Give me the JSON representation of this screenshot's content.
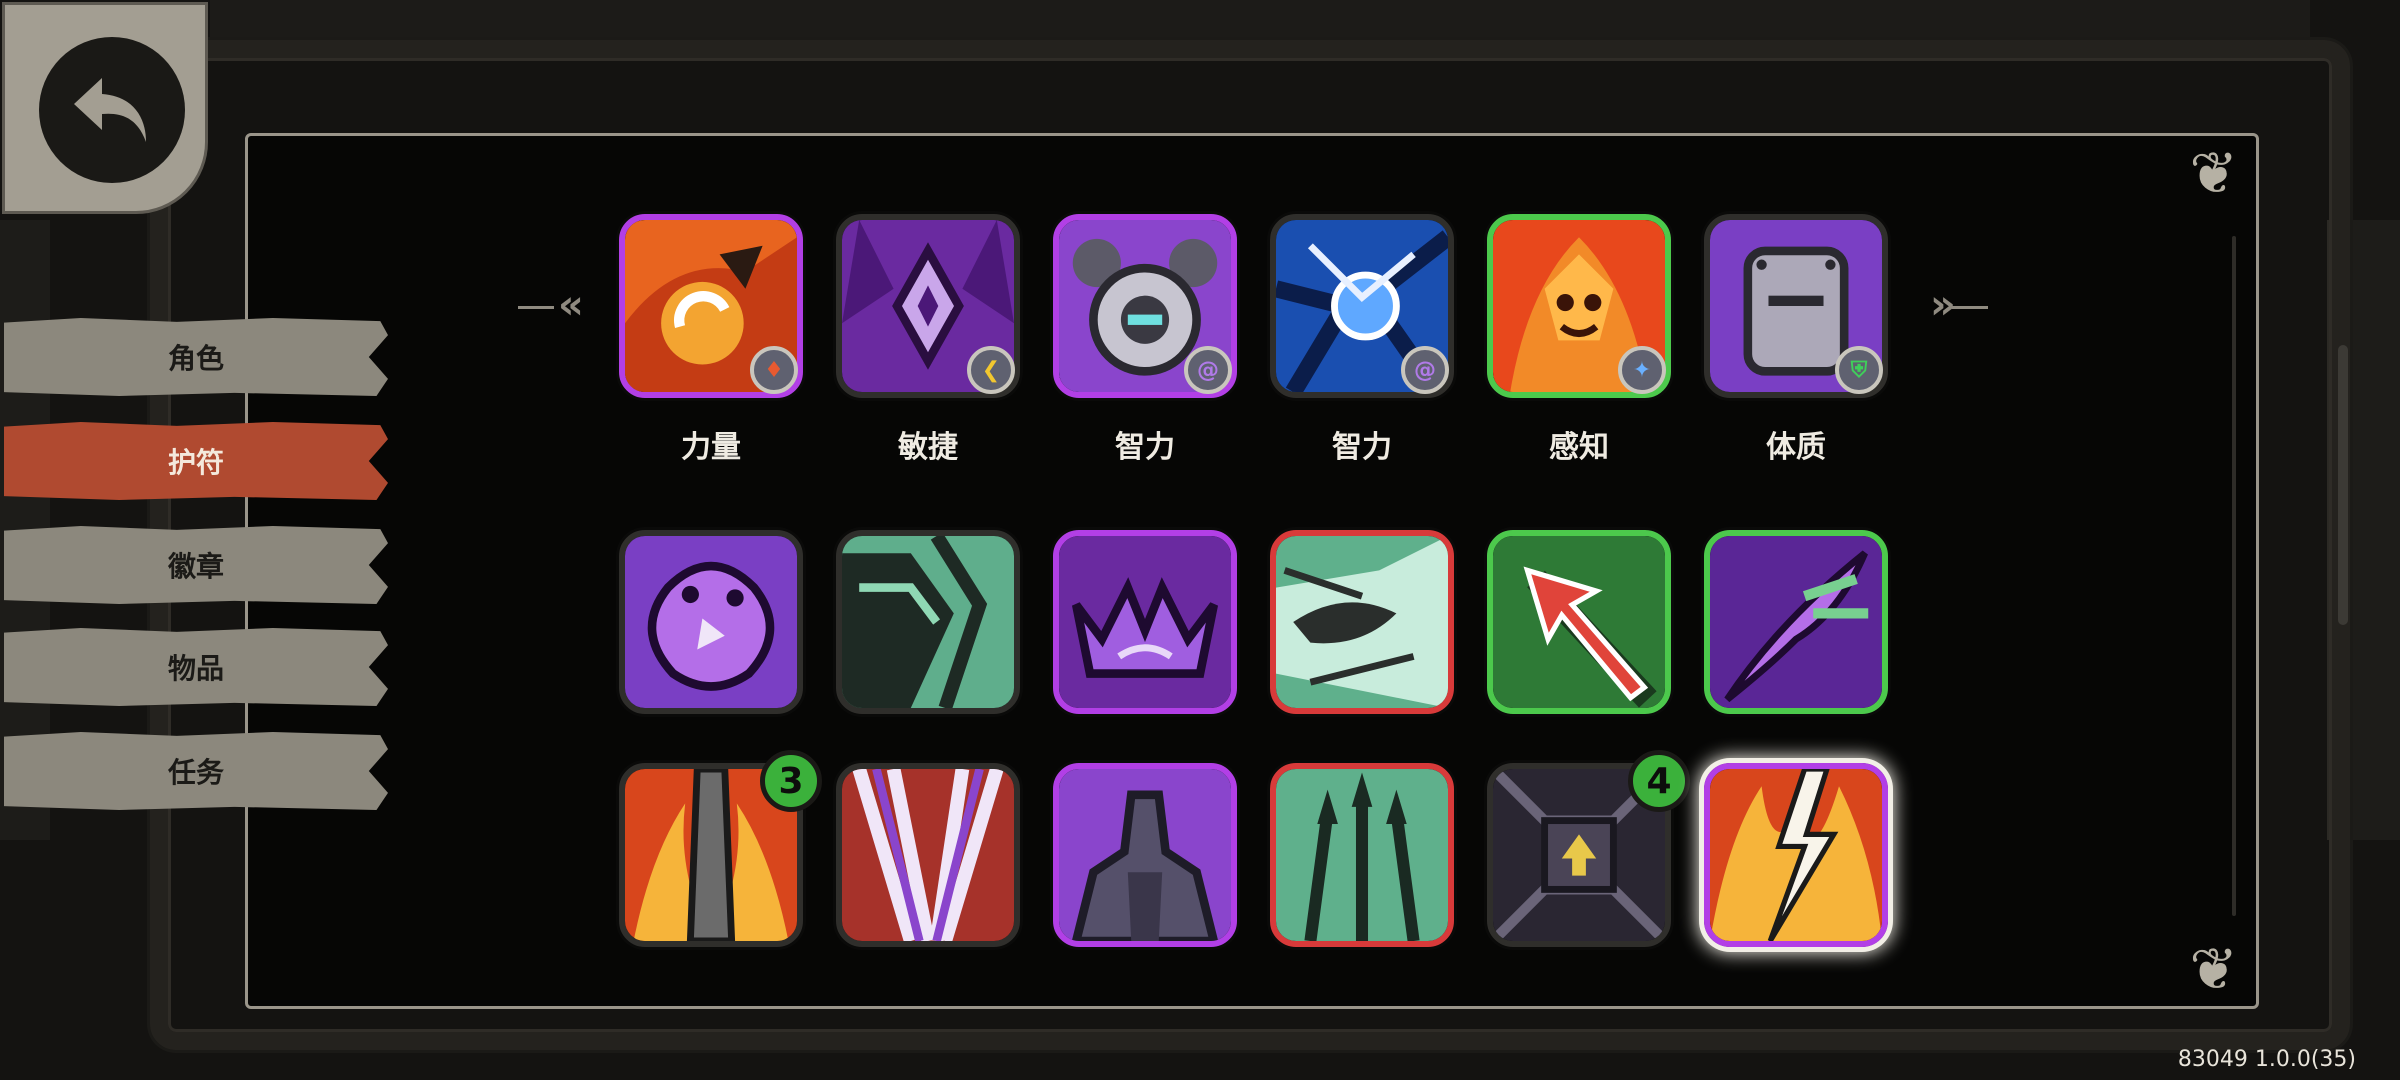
{
  "tabs": [
    {
      "label": "角色",
      "active": false
    },
    {
      "label": "护符",
      "active": true
    },
    {
      "label": "徽章",
      "active": false
    },
    {
      "label": "物品",
      "active": false
    },
    {
      "label": "任务",
      "active": false
    }
  ],
  "stat_row": [
    {
      "label": "力量",
      "icon": "strength-fist-icon",
      "badge_icon": "flame-icon"
    },
    {
      "label": "敏捷",
      "icon": "agility-crystal-icon",
      "badge_icon": "boomerang-icon"
    },
    {
      "label": "智力",
      "icon": "intellect-orb-icon",
      "badge_icon": "swirl-icon"
    },
    {
      "label": "智力",
      "icon": "lightning-orb-icon",
      "badge_icon": "swirl-icon"
    },
    {
      "label": "感知",
      "icon": "fire-spirit-icon",
      "badge_icon": "star-icon"
    },
    {
      "label": "体质",
      "icon": "armor-plate-icon",
      "badge_icon": "shield-icon"
    }
  ],
  "charms_row2": [
    {
      "icon": "purple-blob-icon"
    },
    {
      "icon": "green-wave-icon"
    },
    {
      "icon": "purple-crown-icon"
    },
    {
      "icon": "wind-gust-icon"
    },
    {
      "icon": "red-arrow-icon"
    },
    {
      "icon": "purple-feather-icon"
    }
  ],
  "charms_row3": [
    {
      "icon": "flaming-blade-icon",
      "count": "3"
    },
    {
      "icon": "red-slashes-icon"
    },
    {
      "icon": "stone-tower-icon"
    },
    {
      "icon": "spear-volley-icon"
    },
    {
      "icon": "dungeon-door-icon",
      "count": "4"
    },
    {
      "icon": "lightning-fire-icon",
      "selected": true
    }
  ],
  "version": "83049 1.0.0(35)"
}
